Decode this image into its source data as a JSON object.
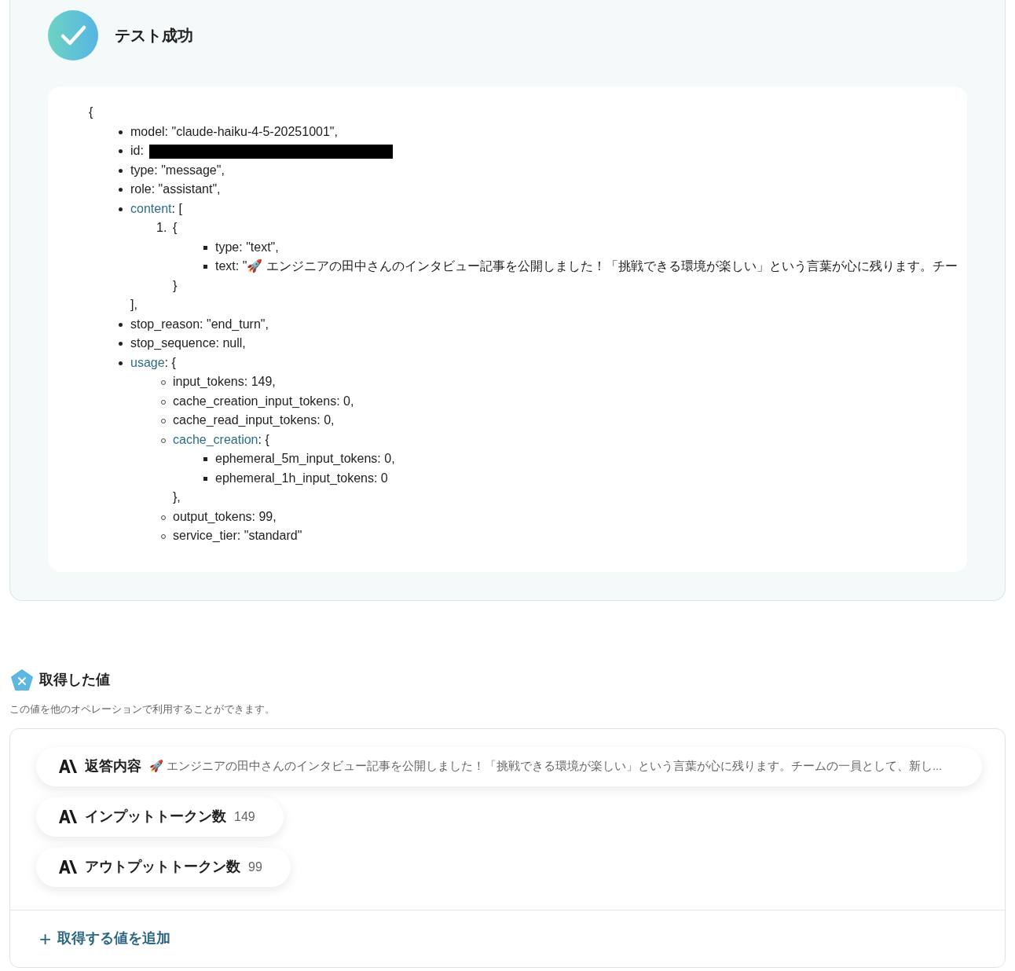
{
  "result_panel": {
    "title": "テスト成功",
    "json_view": {
      "open": "{",
      "items": [
        {
          "kind": "field",
          "key": "model",
          "rest": ": \"claude-haiku-4-5-20251001\","
        },
        {
          "kind": "redacted",
          "key": "id",
          "rest": ":"
        },
        {
          "kind": "field",
          "key": "type",
          "rest": ": \"message\","
        },
        {
          "kind": "field",
          "key": "role",
          "rest": ": \"assistant\","
        },
        {
          "kind": "group",
          "key": "content",
          "rest": ": [",
          "close": "],",
          "children": [
            {
              "kind": "numbered",
              "marker": "1.",
              "rest": "{",
              "close": "}",
              "children": [
                {
                  "kind": "field",
                  "key": "type",
                  "rest": ": \"text\","
                },
                {
                  "kind": "field",
                  "key": "text",
                  "rest": ": \"🚀 エンジニアの田中さんのインタビュー記事を公開しました！「挑戦できる環境が楽しい」という言葉が心に残ります。チー"
                }
              ]
            }
          ]
        },
        {
          "kind": "field",
          "key": "stop_reason",
          "rest": ": \"end_turn\","
        },
        {
          "kind": "field",
          "key": "stop_sequence",
          "rest": ": null,"
        },
        {
          "kind": "group",
          "key": "usage",
          "rest": ": {",
          "children": [
            {
              "kind": "field",
              "key": "input_tokens",
              "rest": ": 149,"
            },
            {
              "kind": "field",
              "key": "cache_creation_input_tokens",
              "rest": ": 0,"
            },
            {
              "kind": "field",
              "key": "cache_read_input_tokens",
              "rest": ": 0,"
            },
            {
              "kind": "group",
              "key": "cache_creation",
              "rest": ": {",
              "close": "},",
              "children": [
                {
                  "kind": "field",
                  "key": "ephemeral_5m_input_tokens",
                  "rest": ": 0,"
                },
                {
                  "kind": "field",
                  "key": "ephemeral_1h_input_tokens",
                  "rest": ": 0"
                }
              ]
            },
            {
              "kind": "field",
              "key": "output_tokens",
              "rest": ": 99,"
            },
            {
              "kind": "field",
              "key": "service_tier",
              "rest": ": \"standard\""
            }
          ]
        }
      ]
    }
  },
  "values_section": {
    "title": "取得した値",
    "description": "この値を他のオペレーションで利用することができます。",
    "values": [
      {
        "label": "返答内容",
        "value": "🚀 エンジニアの田中さんのインタビュー記事を公開しました！「挑戦できる環境が楽しい」という言葉が心に残ります。チームの一員として、新し...",
        "wide": true
      },
      {
        "label": "インプットトークン数",
        "value": "149",
        "wide": false
      },
      {
        "label": "アウトプットトークン数",
        "value": "99",
        "wide": false
      }
    ],
    "add_button": {
      "icon": "+",
      "label": "取得する値を追加"
    }
  }
}
